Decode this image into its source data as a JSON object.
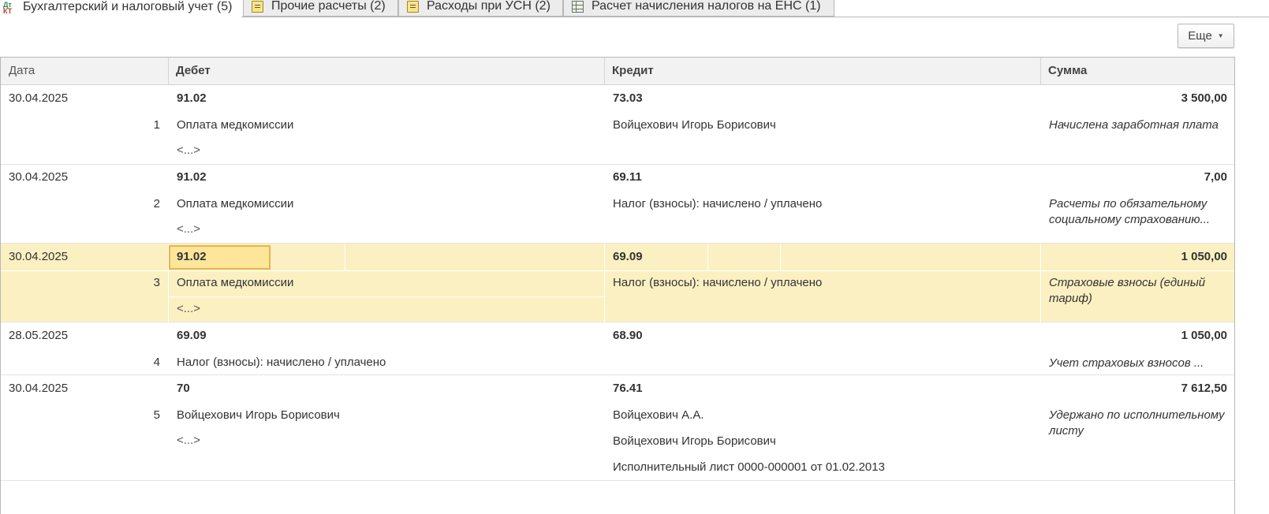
{
  "tabs": [
    {
      "label": "Бухгалтерский и налоговый учет (5)",
      "icon": "dt-kt-icon",
      "active": true
    },
    {
      "label": "Прочие расчеты (2)",
      "icon": "document-icon",
      "active": false
    },
    {
      "label": "Расходы при УСН (2)",
      "icon": "document-icon",
      "active": false
    },
    {
      "label": "Расчет начисления налогов на ЕНС (1)",
      "icon": "table-icon",
      "active": false
    }
  ],
  "icon_kt": {
    "dt": "Дт",
    "kt": "КТ"
  },
  "toolbar": {
    "more_label": "Еще",
    "more_caret": "▼"
  },
  "columns": {
    "date": "Дата",
    "debit": "Дебет",
    "credit": "Кредит",
    "amount": "Сумма"
  },
  "rows": [
    {
      "date": "30.04.2025",
      "num": "1",
      "debit_account": "91.02",
      "debit_sub1": "Оплата медкомиссии",
      "debit_sub2": "<...>",
      "credit_account": "73.03",
      "credit_sub1": "Войцехович Игорь Борисович",
      "credit_sub2": "",
      "credit_sub3": "",
      "amount": "3 500,00",
      "content": "Начислена заработная плата"
    },
    {
      "date": "30.04.2025",
      "num": "2",
      "debit_account": "91.02",
      "debit_sub1": "Оплата медкомиссии",
      "debit_sub2": "<...>",
      "credit_account": "69.11",
      "credit_sub1": "Налог (взносы): начислено / уплачено",
      "credit_sub2": "",
      "credit_sub3": "",
      "amount": "7,00",
      "content": "Расчеты по обязательному социальному страхованию..."
    },
    {
      "date": "30.04.2025",
      "num": "3",
      "debit_account": "91.02",
      "debit_sub1": "Оплата медкомиссии",
      "debit_sub2": "<...>",
      "credit_account": "69.09",
      "credit_sub1": "Налог (взносы): начислено / уплачено",
      "credit_sub2": "",
      "credit_sub3": "",
      "amount": "1 050,00",
      "content": "Страховые взносы (единый тариф)"
    },
    {
      "date": "28.05.2025",
      "num": "4",
      "debit_account": "69.09",
      "debit_sub1": "Налог (взносы): начислено / уплачено",
      "debit_sub2": "",
      "credit_account": "68.90",
      "credit_sub1": "",
      "credit_sub2": "",
      "credit_sub3": "",
      "amount": "1 050,00",
      "content": "Учет страховых взносов ..."
    },
    {
      "date": "30.04.2025",
      "num": "5",
      "debit_account": "70",
      "debit_sub1": "Войцехович Игорь Борисович",
      "debit_sub2": "<...>",
      "credit_account": "76.41",
      "credit_sub1": "Войцехович А.А.",
      "credit_sub2": "Войцехович Игорь Борисович",
      "credit_sub3": "Исполнительный лист 0000-000001 от 01.02.2013",
      "amount": "7 612,50",
      "content": "Удержано по исполнительному листу"
    }
  ],
  "selected_row": 3,
  "colors": {
    "selection": "#fbf0c2",
    "focus": "#fde59a",
    "focus_border": "#e8b54a",
    "header": "#f2f2f2"
  }
}
